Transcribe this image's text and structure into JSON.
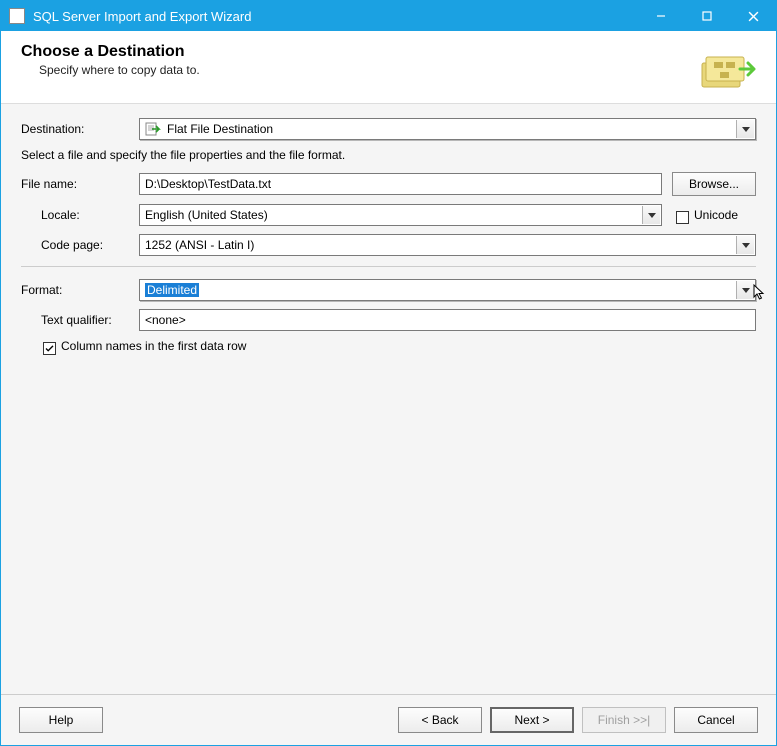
{
  "window": {
    "title": "SQL Server Import and Export Wizard"
  },
  "header": {
    "title": "Choose a Destination",
    "subtitle": "Specify where to copy data to."
  },
  "labels": {
    "destination": "Destination:",
    "instruction": "Select a file and specify the file properties and the file format.",
    "file_name": "File name:",
    "browse": "Browse...",
    "locale": "Locale:",
    "unicode": "Unicode",
    "code_page": "Code page:",
    "format": "Format:",
    "text_qualifier": "Text qualifier:",
    "col_names": "Column names in the first data row"
  },
  "values": {
    "destination": "Flat File Destination",
    "file_name": "D:\\Desktop\\TestData.txt",
    "locale": "English (United States)",
    "unicode_checked": false,
    "code_page": "1252  (ANSI - Latin I)",
    "format": "Delimited",
    "text_qualifier": "<none>",
    "col_names_checked": true
  },
  "footer": {
    "help": "Help",
    "back": "< Back",
    "next": "Next >",
    "finish": "Finish >>|",
    "cancel": "Cancel"
  }
}
